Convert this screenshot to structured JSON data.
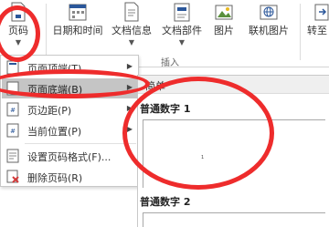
{
  "ribbon": {
    "buttons": [
      {
        "label": "页码"
      },
      {
        "label": "日期和时间"
      },
      {
        "label": "文档信息"
      },
      {
        "label": "文档部件"
      },
      {
        "label": "图片"
      },
      {
        "label": "联机图片"
      },
      {
        "label": "转至"
      }
    ],
    "group_label": "插入"
  },
  "menu": {
    "items": [
      {
        "label": "页面顶端(T)"
      },
      {
        "label": "页面底端(B)"
      },
      {
        "label": "页边距(P)"
      },
      {
        "label": "当前位置(P)"
      },
      {
        "label": "设置页码格式(F)..."
      },
      {
        "label": "删除页码(R)"
      }
    ]
  },
  "gallery": {
    "section": "简单",
    "items": [
      {
        "label": "普通数字 1",
        "preview_number": "1"
      },
      {
        "label": "普通数字 2"
      }
    ]
  },
  "colors": {
    "annotation": "#ee2c2c",
    "highlight": "#c5c5c5",
    "accent": "#2b579a"
  }
}
